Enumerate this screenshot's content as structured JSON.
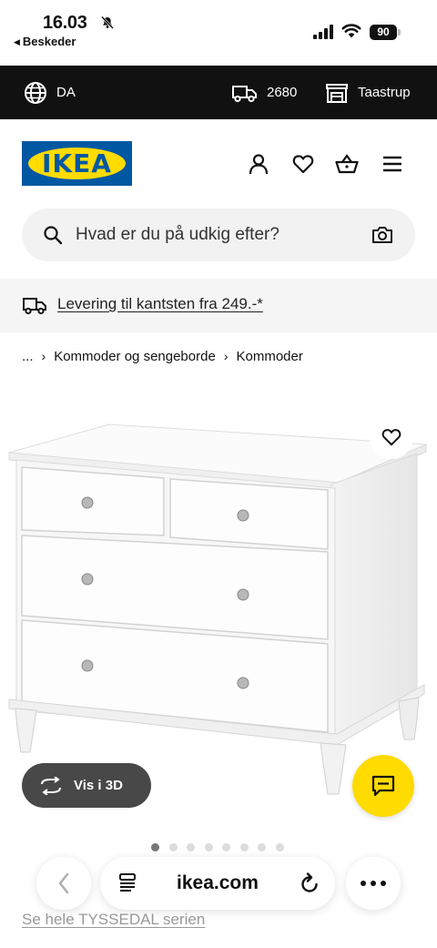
{
  "status_bar": {
    "time": "16.03",
    "back_app": "Beskeder",
    "battery": "90"
  },
  "top_bar": {
    "language": "DA",
    "postcode": "2680",
    "store": "Taastrup"
  },
  "header": {
    "logo_text": "IKEA",
    "brand_colors": {
      "blue": "#0058a3",
      "yellow": "#ffdb00"
    },
    "icons": [
      "user-icon",
      "heart-icon",
      "basket-icon",
      "menu-icon"
    ]
  },
  "search": {
    "placeholder": "Hvad er du på udkig efter?"
  },
  "delivery_banner": {
    "text": "Levering til kantsten fra 249.-*"
  },
  "breadcrumb": {
    "items": [
      "...",
      "Kommoder og sengeborde",
      "Kommoder"
    ]
  },
  "product": {
    "view_3d_label": "Vis i 3D",
    "image_count": 8,
    "active_image": 1,
    "series_link": "Se hele TYSSEDAL serien"
  },
  "safari": {
    "domain": "ikea.com"
  }
}
